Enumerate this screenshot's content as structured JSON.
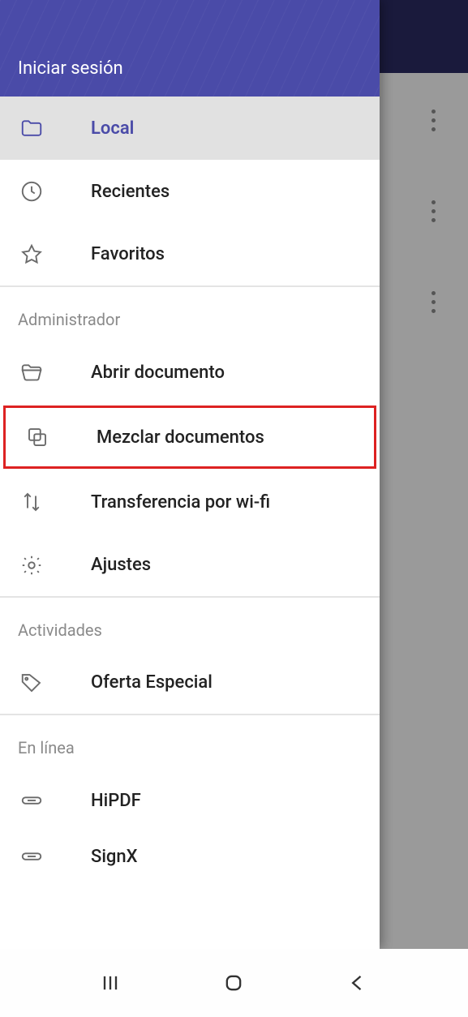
{
  "header": {
    "signin_label": "Iniciar sesión"
  },
  "nav": {
    "local": "Local",
    "recent": "Recientes",
    "favorites": "Favoritos"
  },
  "sections": {
    "admin": {
      "title": "Administrador",
      "open_doc": "Abrir documento",
      "merge_docs": "Mezclar documentos",
      "wifi_transfer": "Transferencia por wi-fi",
      "settings": "Ajustes"
    },
    "activities": {
      "title": "Actividades",
      "special_offer": "Oferta Especial"
    },
    "online": {
      "title": "En línea",
      "hipdf": "HiPDF",
      "signx": "SignX"
    }
  }
}
